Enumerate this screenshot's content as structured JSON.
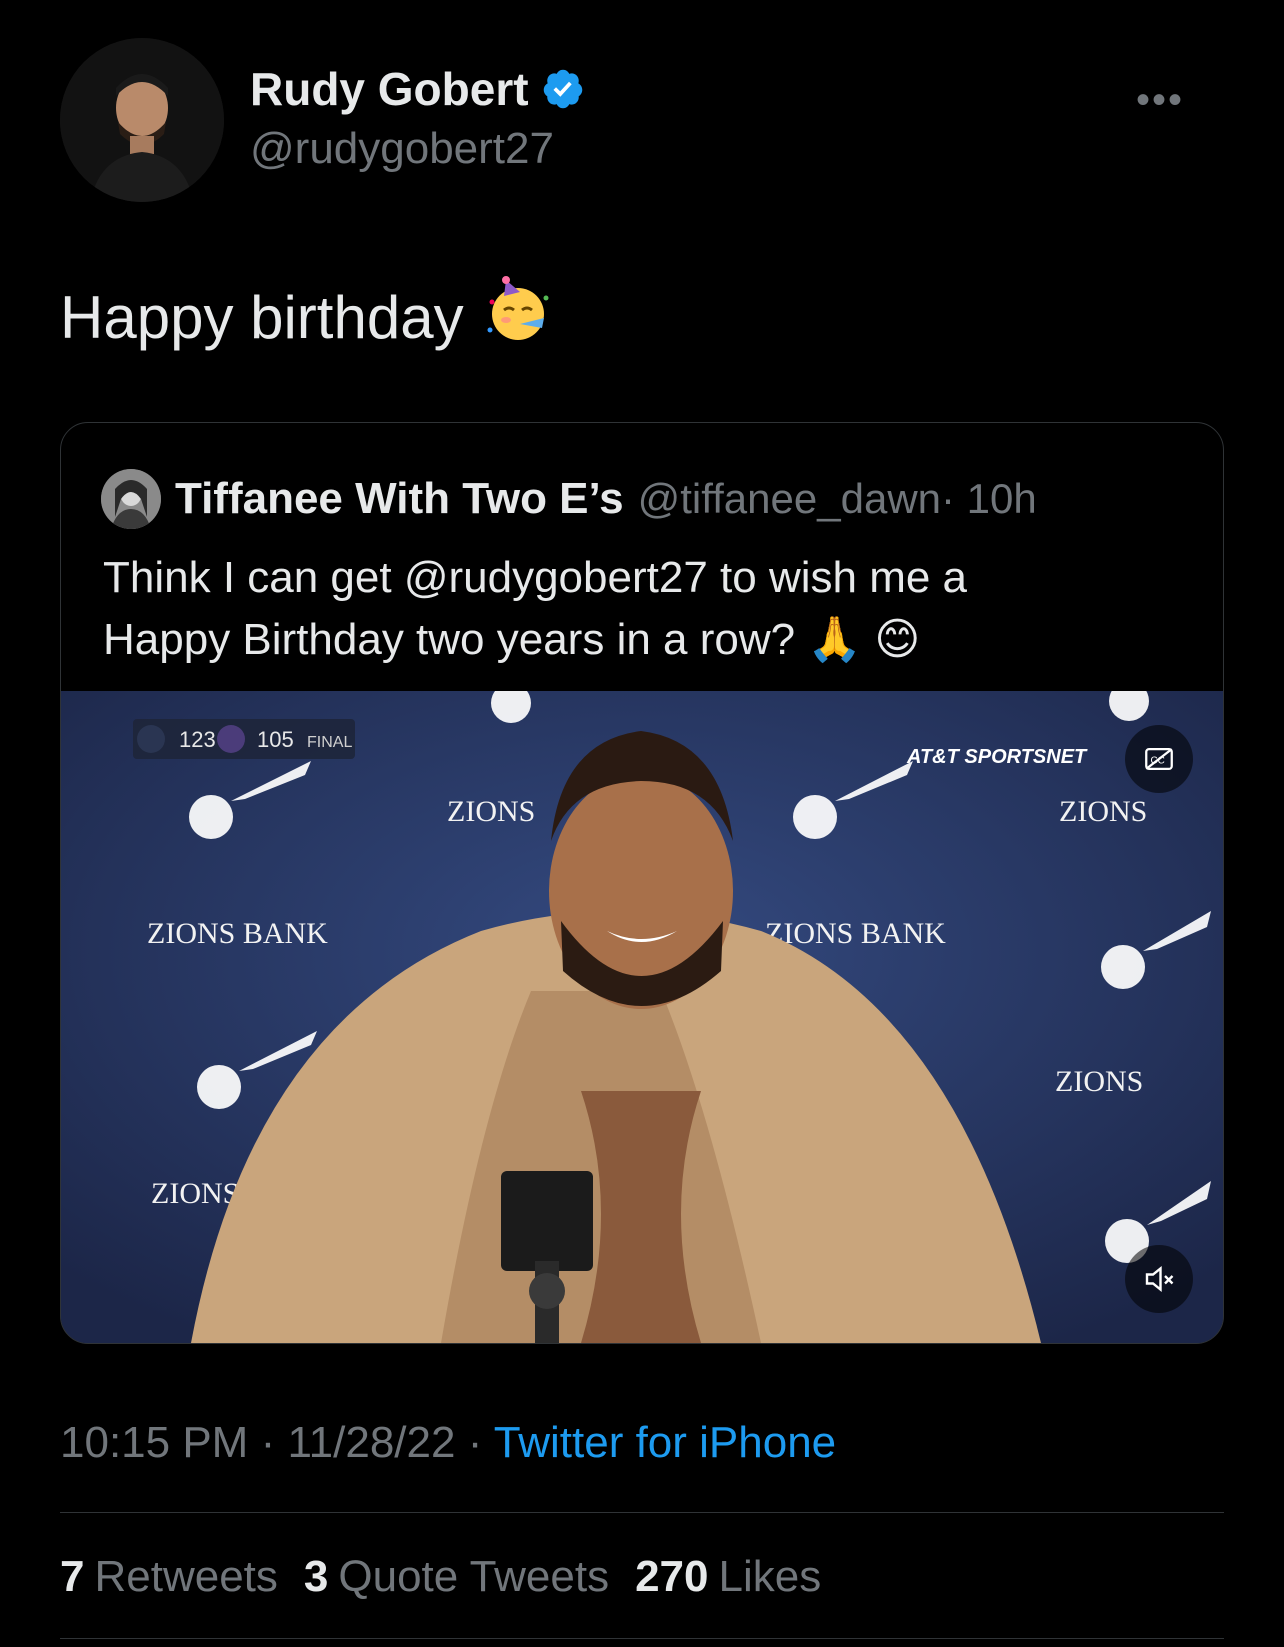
{
  "author": {
    "name": "Rudy Gobert",
    "handle": "@rudygobert27"
  },
  "tweet": {
    "text": "Happy birthday",
    "emoji": "🥳"
  },
  "quote": {
    "name": "Tiffanee With Two E’s",
    "handle": "@tiffanee_dawn",
    "age": "· 10h",
    "text_line1_pre": "Think I can get ",
    "text_mention": "@rudygobert27",
    "text_line1_post": " to wish me a",
    "text_line2": "Happy Birthday two years in a row? ",
    "text_emoji": "🙏 😊",
    "video": {
      "scorebug_home": "123",
      "scorebug_away": "105",
      "scorebug_status": "FINAL",
      "network": "AT&T SPORTSNET",
      "backdrop_texts": [
        "ZIONS",
        "ZIONS",
        "ZIONS BANK",
        "ZIONS BANK",
        "ZIONS",
        "ZIONS"
      ]
    }
  },
  "meta": {
    "time": "10:15 PM",
    "date": "11/28/22",
    "source": "Twitter for iPhone",
    "sep": " · "
  },
  "stats": {
    "retweets_count": "7",
    "retweets_label": "Retweets",
    "quotes_count": "3",
    "quotes_label": "Quote Tweets",
    "likes_count": "270",
    "likes_label": "Likes"
  },
  "colors": {
    "background": "#000000",
    "accent": "#1d9bf0",
    "muted": "#71767b",
    "video_backdrop": "#2b3a66"
  }
}
